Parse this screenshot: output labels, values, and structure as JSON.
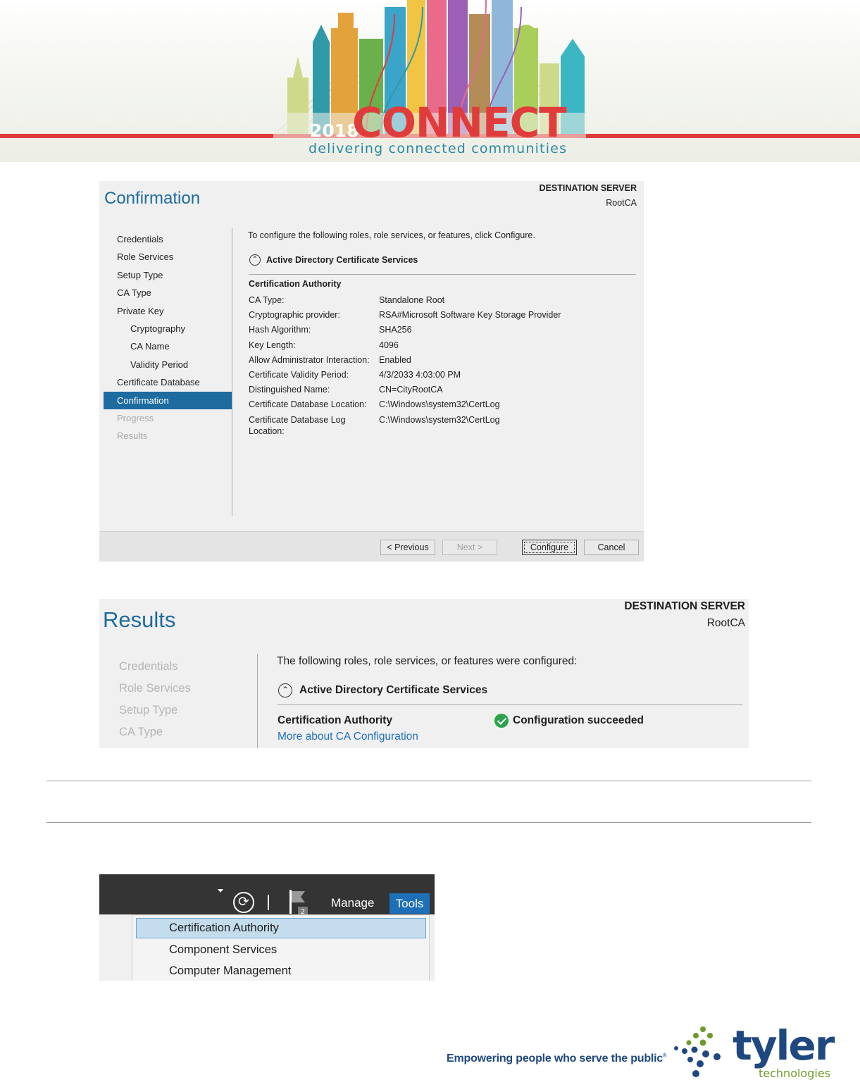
{
  "banner": {
    "year": "2018",
    "word": "CONNECT",
    "tagline": "delivering connected communities"
  },
  "confirmation": {
    "title": "Confirmation",
    "dest_label": "DESTINATION SERVER",
    "dest_name": "RootCA",
    "nav": [
      {
        "label": "Credentials",
        "state": "normal",
        "indent": false
      },
      {
        "label": "Role Services",
        "state": "normal",
        "indent": false
      },
      {
        "label": "Setup Type",
        "state": "normal",
        "indent": false
      },
      {
        "label": "CA Type",
        "state": "normal",
        "indent": false
      },
      {
        "label": "Private Key",
        "state": "normal",
        "indent": false
      },
      {
        "label": "Cryptography",
        "state": "normal",
        "indent": true
      },
      {
        "label": "CA Name",
        "state": "normal",
        "indent": true
      },
      {
        "label": "Validity Period",
        "state": "normal",
        "indent": true
      },
      {
        "label": "Certificate Database",
        "state": "normal",
        "indent": false
      },
      {
        "label": "Confirmation",
        "state": "active",
        "indent": false
      },
      {
        "label": "Progress",
        "state": "disabled",
        "indent": false
      },
      {
        "label": "Results",
        "state": "disabled",
        "indent": false
      }
    ],
    "intro": "To configure the following roles, role services, or features, click Configure.",
    "section": "Active Directory Certificate Services",
    "group": "Certification Authority",
    "rows": [
      {
        "key": "CA Type:",
        "value": "Standalone Root"
      },
      {
        "key": "Cryptographic provider:",
        "value": "RSA#Microsoft Software Key Storage Provider"
      },
      {
        "key": "Hash Algorithm:",
        "value": "SHA256"
      },
      {
        "key": "Key Length:",
        "value": "4096"
      },
      {
        "key": "Allow Administrator Interaction:",
        "value": "Enabled"
      },
      {
        "key": "Certificate Validity Period:",
        "value": "4/3/2033 4:03:00 PM"
      },
      {
        "key": "Distinguished Name:",
        "value": "CN=CityRootCA"
      },
      {
        "key": "Certificate Database Location:",
        "value": "C:\\Windows\\system32\\CertLog"
      },
      {
        "key": "Certificate Database Log Location:",
        "value": "C:\\Windows\\system32\\CertLog"
      }
    ],
    "buttons": {
      "previous": "< Previous",
      "next": "Next >",
      "configure": "Configure",
      "cancel": "Cancel"
    }
  },
  "results": {
    "title": "Results",
    "dest_label": "DESTINATION SERVER",
    "dest_name": "RootCA",
    "nav": [
      "Credentials",
      "Role Services",
      "Setup Type",
      "CA Type"
    ],
    "intro": "The following roles, role services, or features were configured:",
    "section": "Active Directory Certificate Services",
    "group": "Certification Authority",
    "status": "Configuration succeeded",
    "link": "More about CA Configuration"
  },
  "server_manager": {
    "flag_badge": "2",
    "manage": "Manage",
    "tools": "Tools",
    "menu": [
      "Certification Authority",
      "Component Services",
      "Computer Management"
    ]
  },
  "footer": {
    "tagline": "Empowering people who serve the public",
    "brand": "tyler",
    "brand_sub": "technologies"
  },
  "colors": {
    "accent_blue": "#1d6b9f",
    "success_green": "#2ca24c",
    "tyler_navy": "#1f4880",
    "tyler_green": "#6e9a2a",
    "connect_red": "#e13c3c"
  }
}
